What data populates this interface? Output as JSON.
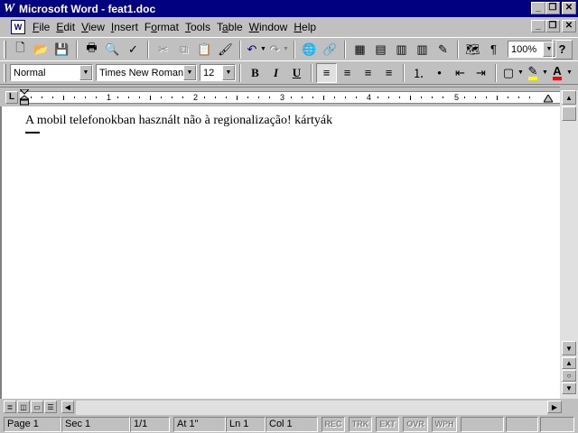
{
  "window": {
    "app_icon_glyph": "W",
    "title": "Microsoft Word - feat1.doc",
    "minimize_glyph": "_",
    "restore_glyph": "❐",
    "close_glyph": "✕"
  },
  "menubar": {
    "doc_icon_glyph": "W",
    "items": [
      {
        "accel": "F",
        "rest": "ile"
      },
      {
        "accel": "E",
        "rest": "dit"
      },
      {
        "accel": "V",
        "rest": "iew"
      },
      {
        "accel": "I",
        "rest": "nsert"
      },
      {
        "pre": "F",
        "accel": "o",
        "rest": "rmat"
      },
      {
        "accel": "T",
        "rest": "ools"
      },
      {
        "pre": "T",
        "accel": "a",
        "rest": "ble"
      },
      {
        "accel": "W",
        "rest": "indow"
      },
      {
        "accel": "H",
        "rest": "elp"
      }
    ]
  },
  "standard_toolbar": {
    "icons": {
      "new": "🗋",
      "open": "📂",
      "save": "💾",
      "print": "🖶",
      "preview": "🔍",
      "spelling": "✓",
      "cut": "✂",
      "copy": "⧉",
      "paste": "📋",
      "format_painter": "🖌",
      "undo": "↶",
      "redo": "↷",
      "web": "🌐",
      "hyperlink": "🔗",
      "tables_borders": "▦",
      "insert_table": "▤",
      "insert_excel": "▥",
      "columns": "▥",
      "drawing": "✎",
      "doc_map": "🗺",
      "show_hide": "¶",
      "help": "?"
    },
    "zoom": "100%"
  },
  "format_toolbar": {
    "style": "Normal",
    "font": "Times New Roman",
    "size": "12",
    "bold": "B",
    "italic": "I",
    "underline": "U",
    "icons": {
      "align_left": "≡",
      "center": "≡",
      "align_right": "≡",
      "justify": "≡",
      "numbering": "⒈",
      "bullets": "•",
      "decrease_indent": "⇤",
      "increase_indent": "⇥",
      "borders": "▢",
      "highlight": "✎",
      "font_color": "A"
    },
    "colors": {
      "highlight": "#ffff00",
      "font_color": "#ff0000"
    }
  },
  "ruler": {
    "tab_selector": "L",
    "numbers": [
      "1",
      "2",
      "3",
      "4",
      "5"
    ]
  },
  "document": {
    "text": "A mobil telefonokban használt não à regionalização! kártyák"
  },
  "statusbar": {
    "page": "Page 1",
    "sec": "Sec 1",
    "page_count": "1/1",
    "at": "At 1\"",
    "ln": "Ln 1",
    "col": "Col 1",
    "modes": [
      "REC",
      "TRK",
      "EXT",
      "OVR",
      "WPH"
    ]
  }
}
